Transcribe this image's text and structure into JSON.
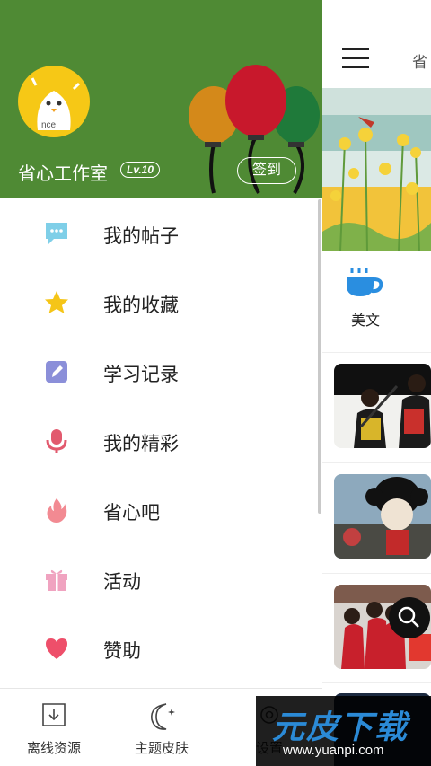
{
  "drawer": {
    "username": "省心工作室",
    "level": "Lv.10",
    "signin_label": "签到",
    "avatar_text": "nce",
    "menu": [
      {
        "label": "我的帖子",
        "icon": "chat-bubble-icon",
        "color": "#7fcfe8"
      },
      {
        "label": "我的收藏",
        "icon": "star-icon",
        "color": "#f5c518"
      },
      {
        "label": "学习记录",
        "icon": "edit-note-icon",
        "color": "#8b8fd9"
      },
      {
        "label": "我的精彩",
        "icon": "microphone-icon",
        "color": "#e25a6e"
      },
      {
        "label": "省心吧",
        "icon": "flame-icon",
        "color": "#f28a92"
      },
      {
        "label": "活动",
        "icon": "gift-icon",
        "color": "#f0a3c0"
      },
      {
        "label": "赞助",
        "icon": "heart-icon",
        "color": "#ee4f6a"
      }
    ],
    "bottom": [
      {
        "label": "离线资源",
        "icon": "download-icon"
      },
      {
        "label": "主题皮肤",
        "icon": "moon-icon"
      },
      {
        "label": "设置",
        "icon": "gear-icon"
      }
    ]
  },
  "right": {
    "title_partial": "省",
    "category": "美文"
  },
  "watermark": {
    "brand": "元皮下载",
    "url": "www.yuanpi.com"
  },
  "colors": {
    "header_green": "#4f8a34"
  }
}
